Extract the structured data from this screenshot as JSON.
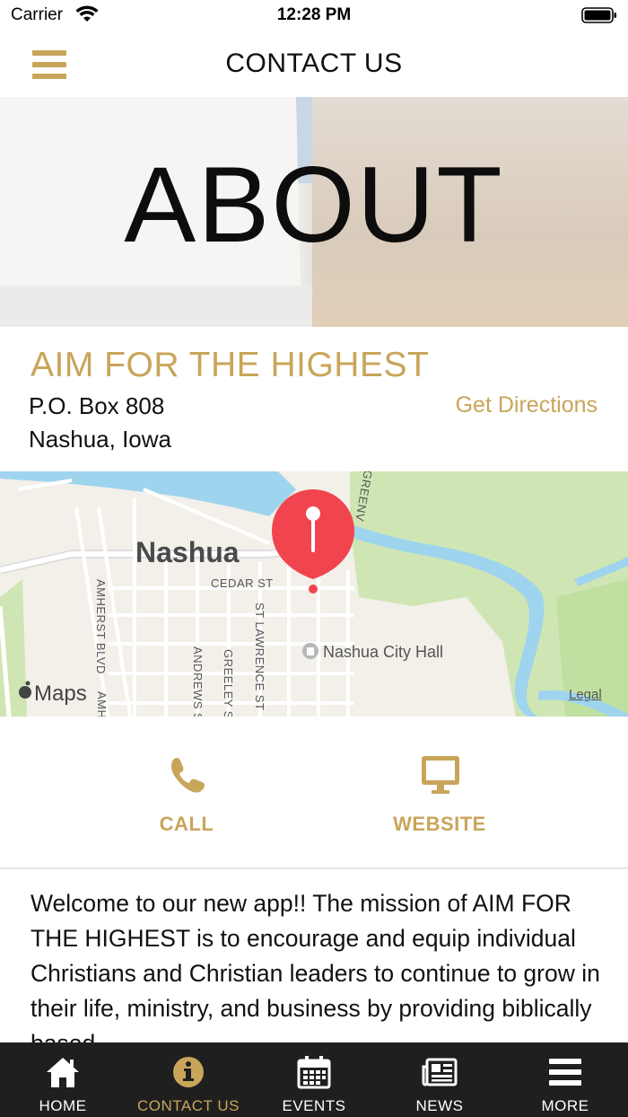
{
  "status_bar": {
    "carrier": "Carrier",
    "time": "12:28 PM"
  },
  "nav": {
    "title": "CONTACT US"
  },
  "hero": {
    "title": "ABOUT"
  },
  "contact": {
    "org_name": "AIM FOR THE HIGHEST",
    "address_line1": "P.O. Box 808",
    "address_line2": "Nashua, Iowa",
    "directions_label": "Get Directions"
  },
  "map": {
    "city_label": "Nashua",
    "cedar_st": "CEDAR ST",
    "city_hall": "Nashua City Hall",
    "amherst_blvd": "AMHERST BLVD",
    "amherst_short": "AMH",
    "andrews_st": "ANDREWS S",
    "greeley_st": "GREELEY S",
    "st_lawrence_st": "ST LAWRENCE ST",
    "greenv": "GREENV",
    "maps_logo": "Maps",
    "legal": "Legal"
  },
  "actions": {
    "call_label": "CALL",
    "website_label": "WEBSITE"
  },
  "description": "Welcome to our new app!!   The mission of AIM FOR THE HIGHEST is to encourage and equip individual Christians and Christian leaders to continue to grow in their life, ministry, and business by providing biblically based",
  "tabs": [
    {
      "label": "HOME",
      "icon": "home-icon",
      "active": false
    },
    {
      "label": "CONTACT US",
      "icon": "info-icon",
      "active": true
    },
    {
      "label": "EVENTS",
      "icon": "calendar-icon",
      "active": false
    },
    {
      "label": "NEWS",
      "icon": "newspaper-icon",
      "active": false
    },
    {
      "label": "MORE",
      "icon": "menu-icon",
      "active": false
    }
  ],
  "colors": {
    "accent": "#c9a55a",
    "tab_bar": "#1f1f1f",
    "pin": "#f0454f",
    "water": "#9fd4ee",
    "park": "#cfe6b4"
  }
}
